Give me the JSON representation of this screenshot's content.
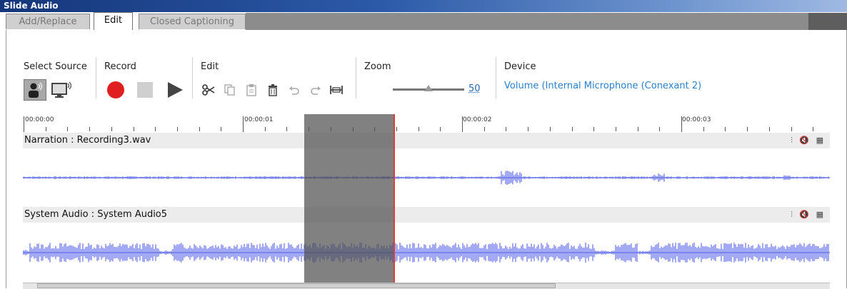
{
  "window": {
    "title": "Slide Audio"
  },
  "tabs": [
    {
      "label": "Add/Replace",
      "active": false
    },
    {
      "label": "Edit",
      "active": true
    },
    {
      "label": "Closed Captioning",
      "active": false
    }
  ],
  "toolbar": {
    "select_source": {
      "label": "Select Source",
      "buttons": [
        "microphone-source-icon",
        "system-audio-source-icon"
      ]
    },
    "record": {
      "label": "Record",
      "buttons": [
        "record-icon",
        "stop-icon",
        "play-icon"
      ]
    },
    "edit": {
      "label": "Edit",
      "buttons": [
        "cut-icon",
        "copy-icon",
        "paste-icon",
        "delete-icon",
        "undo-icon",
        "redo-icon",
        "insert-silence-icon"
      ]
    },
    "zoom": {
      "label": "Zoom",
      "value": "50"
    },
    "device": {
      "label": "Device",
      "value": "Volume (Internal Microphone (Conexant 2)"
    }
  },
  "timeline": {
    "ruler_labels": [
      "00:00:00",
      "00:00:01",
      "00:00:02",
      "00:00:03"
    ],
    "tracks": [
      {
        "label": "Narration : Recording3.wav",
        "icons": [
          "audio-settings-icon",
          "mute-icon",
          "waveform-edit-icon"
        ]
      },
      {
        "label": "System Audio : System Audio5",
        "icons": [
          "audio-settings-icon",
          "mute-icon",
          "waveform-edit-icon"
        ]
      }
    ]
  },
  "colors": {
    "accent": "#2a7fcc",
    "record": "#e02020",
    "waveform": "#7b86ee",
    "selection": "#6a6a6a",
    "playhead": "#e23b3b"
  }
}
